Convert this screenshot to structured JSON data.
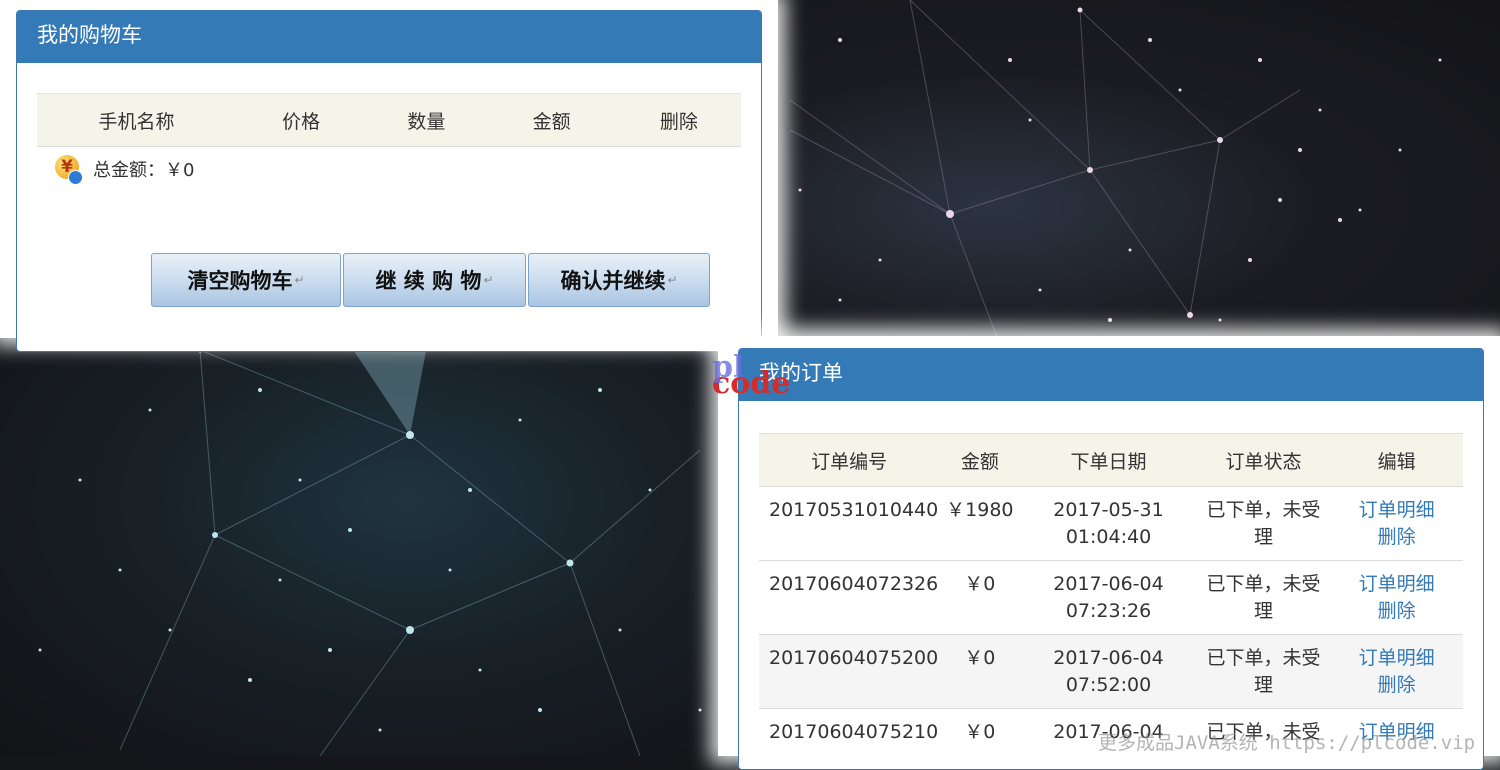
{
  "cart": {
    "title": "我的购物车",
    "columns": [
      "手机名称",
      "价格",
      "数量",
      "金额",
      "删除"
    ],
    "total_text": "总金额：￥0",
    "buttons": {
      "clear": "清空购物车",
      "continue": "继 续 购 物",
      "confirm": "确认并继续"
    },
    "return_mark": "↵"
  },
  "orders": {
    "title": "我的订单",
    "columns": [
      "订单编号",
      "金额",
      "下单日期",
      "订单状态",
      "编辑"
    ],
    "rows": [
      {
        "id": "20170531010440",
        "amount": "￥1980",
        "date": "2017-05-31",
        "time": "01:04:40",
        "status1": "已下单，未受",
        "status2": "理",
        "detail": "订单明细",
        "delete": "删除"
      },
      {
        "id": "20170604072326",
        "amount": "￥0",
        "date": "2017-06-04",
        "time": "07:23:26",
        "status1": "已下单，未受",
        "status2": "理",
        "detail": "订单明细",
        "delete": "删除"
      },
      {
        "id": "20170604075200",
        "amount": "￥0",
        "date": "2017-06-04",
        "time": "07:52:00",
        "status1": "已下单，未受",
        "status2": "理",
        "detail": "订单明细",
        "delete": "删除"
      },
      {
        "id": "20170604075210",
        "amount": "￥0",
        "date": "2017-06-04",
        "time": "",
        "status1": "已下单，未受",
        "status2": "",
        "detail": "订单明细",
        "delete": ""
      }
    ]
  },
  "logo": {
    "top": "pl",
    "bottom": "code"
  },
  "watermark": "更多成品JAVA系统 https://plcode.vip"
}
